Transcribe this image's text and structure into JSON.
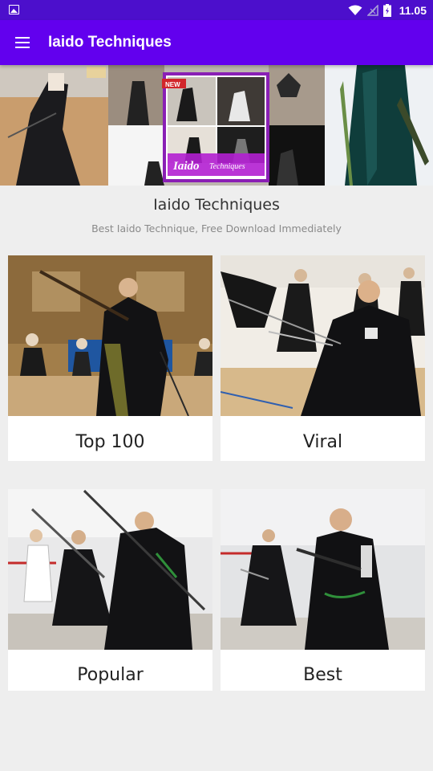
{
  "status_bar": {
    "time": "11.05",
    "icons": [
      "notification-image-icon",
      "wifi-icon",
      "signal-icon",
      "battery-icon"
    ]
  },
  "app_bar": {
    "title": "Iaido Techniques",
    "menu_icon": "hamburger-menu-icon",
    "color": "#6200ee"
  },
  "banner": {
    "badge": "NEW",
    "logo_text": "Iaido Techniques"
  },
  "header": {
    "title": "Iaido Techniques",
    "subtitle": "Best Iaido Technique, Free Download Immediately"
  },
  "categories": [
    {
      "label": "Top 100"
    },
    {
      "label": "Viral"
    },
    {
      "label": "Popular"
    },
    {
      "label": "Best"
    }
  ]
}
